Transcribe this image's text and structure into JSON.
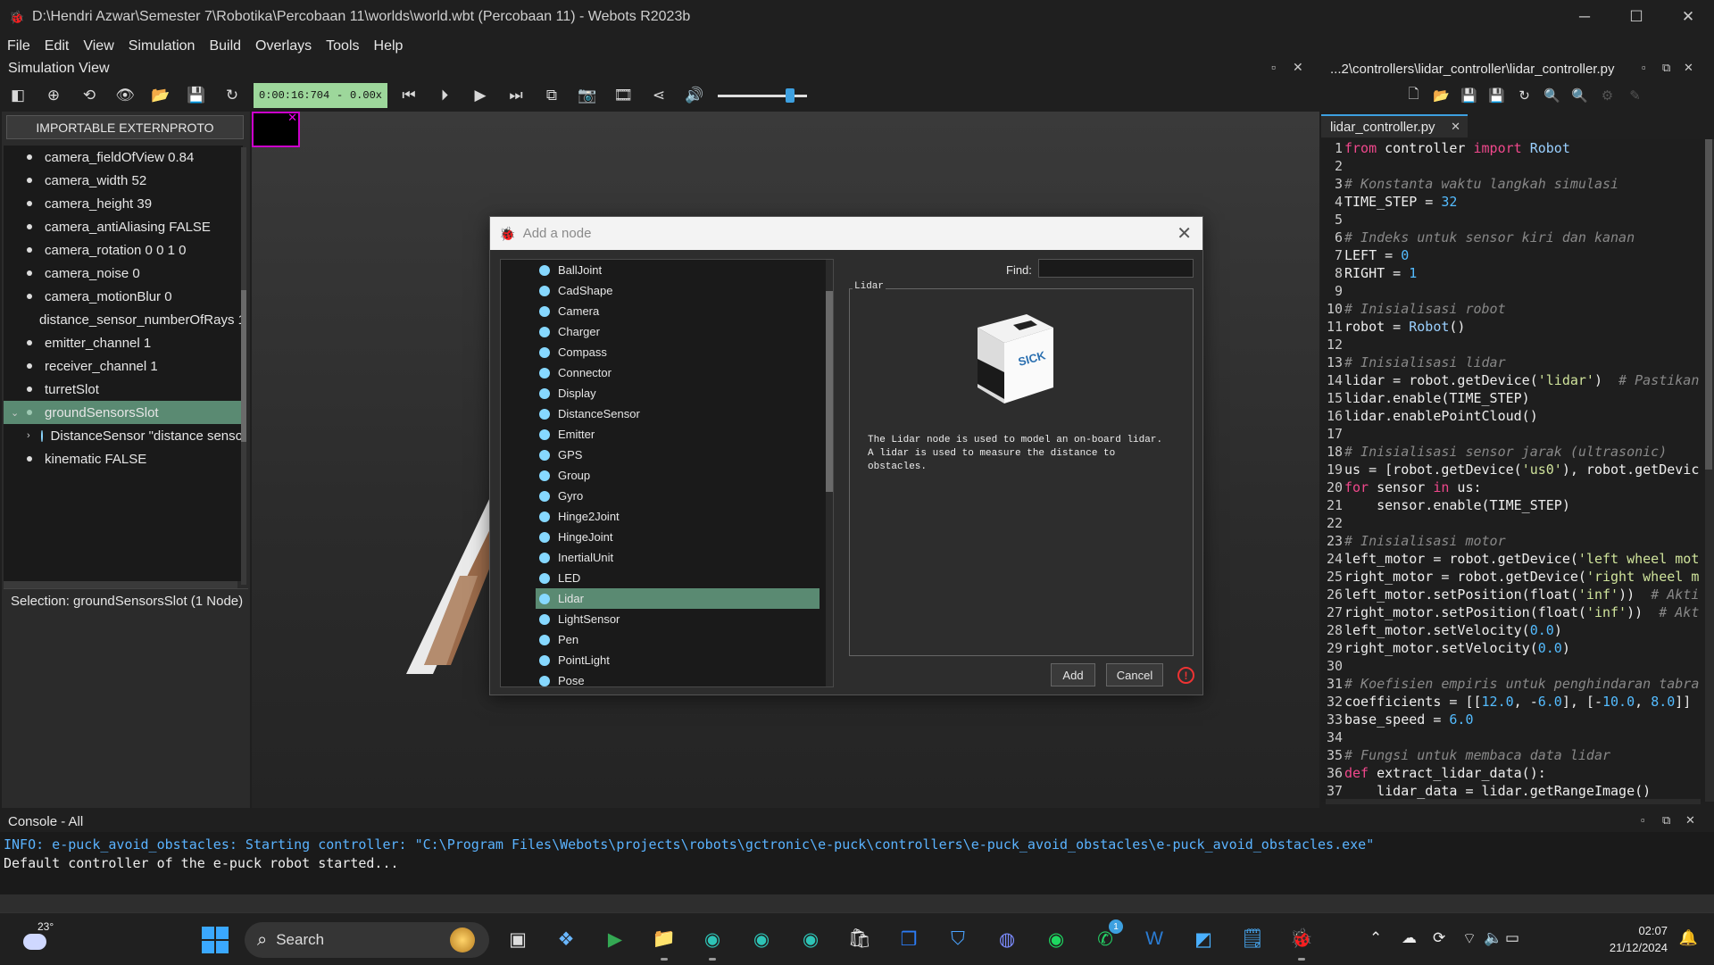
{
  "window": {
    "title": "D:\\Hendri Azwar\\Semester 7\\Robotika\\Percobaan 11\\worlds\\world.wbt (Percobaan 11) - Webots R2023b",
    "minimize": "─",
    "maximize": "☐",
    "close": "✕"
  },
  "menu": [
    "File",
    "Edit",
    "View",
    "Simulation",
    "Build",
    "Overlays",
    "Tools",
    "Help"
  ],
  "simview": {
    "title": "Simulation View"
  },
  "toolbar": {
    "time": "0:00:16:704",
    "separator": "-",
    "speed": "0.00x",
    "volume": 0.75
  },
  "scenetree": {
    "externproto_label": "IMPORTABLE EXTERNPROTO",
    "items": [
      {
        "label": "camera_fieldOfView 0.84"
      },
      {
        "label": "camera_width 52"
      },
      {
        "label": "camera_height 39"
      },
      {
        "label": "camera_antiAliasing FALSE"
      },
      {
        "label": "camera_rotation 0 0 1 0"
      },
      {
        "label": "camera_noise 0"
      },
      {
        "label": "camera_motionBlur 0"
      },
      {
        "label": "distance_sensor_numberOfRays 1"
      },
      {
        "label": "emitter_channel 1"
      },
      {
        "label": "receiver_channel 1"
      },
      {
        "label": "turretSlot"
      },
      {
        "label": "groundSensorsSlot"
      },
      {
        "label": "DistanceSensor \"distance senso"
      },
      {
        "label": "kinematic FALSE"
      }
    ],
    "selection": "Selection: groundSensorsSlot (1 Node)"
  },
  "dialog": {
    "title": "Add a node",
    "find_label": "Find:",
    "find_value": "",
    "nodes": [
      "BallJoint",
      "CadShape",
      "Camera",
      "Charger",
      "Compass",
      "Connector",
      "Display",
      "DistanceSensor",
      "Emitter",
      "GPS",
      "Group",
      "Gyro",
      "Hinge2Joint",
      "HingeJoint",
      "InertialUnit",
      "LED",
      "Lidar",
      "LightSensor",
      "Pen",
      "PointLight",
      "Pose"
    ],
    "selected_node": "Lidar",
    "preview_title": "Lidar",
    "preview_logo": "SICK",
    "description": "The Lidar node is used to model an on-board lidar. A lidar is used to measure the distance to obstacles.",
    "add_label": "Add",
    "cancel_label": "Cancel"
  },
  "editor": {
    "path": "...2\\controllers\\lidar_controller\\lidar_controller.py",
    "tab": "lidar_controller.py",
    "lines": [
      "from controller import Robot",
      "",
      "# Konstanta waktu langkah simulasi",
      "TIME_STEP = 32",
      "",
      "# Indeks untuk sensor kiri dan kanan",
      "LEFT = 0",
      "RIGHT = 1",
      "",
      "# Inisialisasi robot",
      "robot = Robot()",
      "",
      "# Inisialisasi lidar",
      "lidar = robot.getDevice('lidar')  # Pastikan",
      "lidar.enable(TIME_STEP)",
      "lidar.enablePointCloud()",
      "",
      "# Inisialisasi sensor jarak (ultrasonic)",
      "us = [robot.getDevice('us0'), robot.getDevic",
      "for sensor in us:",
      "    sensor.enable(TIME_STEP)",
      "",
      "# Inisialisasi motor",
      "left_motor = robot.getDevice('left wheel mot",
      "right_motor = robot.getDevice('right wheel m",
      "left_motor.setPosition(float('inf'))  # Akti",
      "right_motor.setPosition(float('inf'))  # Akt",
      "left_motor.setVelocity(0.0)",
      "right_motor.setVelocity(0.0)",
      "",
      "# Koefisien empiris untuk penghindaran tabra",
      "coefficients = [[12.0, -6.0], [-10.0, 8.0]]",
      "base_speed = 6.0",
      "",
      "# Fungsi untuk membaca data lidar",
      "def extract_lidar_data():",
      "    lidar_data = lidar.getRangeImage()"
    ]
  },
  "console": {
    "title": "Console - All",
    "lines": [
      "INFO: e-puck_avoid_obstacles: Starting controller: \"C:\\Program Files\\Webots\\projects\\robots\\gctronic\\e-puck\\controllers\\e-puck_avoid_obstacles\\e-puck_avoid_obstacles.exe\"",
      "Default controller of the e-puck robot started..."
    ]
  },
  "taskbar": {
    "temperature": "23°",
    "search_label": "Search",
    "time": "02:07",
    "date": "21/12/2024",
    "whatsapp_badge": "1"
  },
  "colors": {
    "accent": "#3da0e0",
    "selection": "#5a8a72",
    "time_box": "#9dd79b",
    "info_text": "#5ab3ff"
  }
}
